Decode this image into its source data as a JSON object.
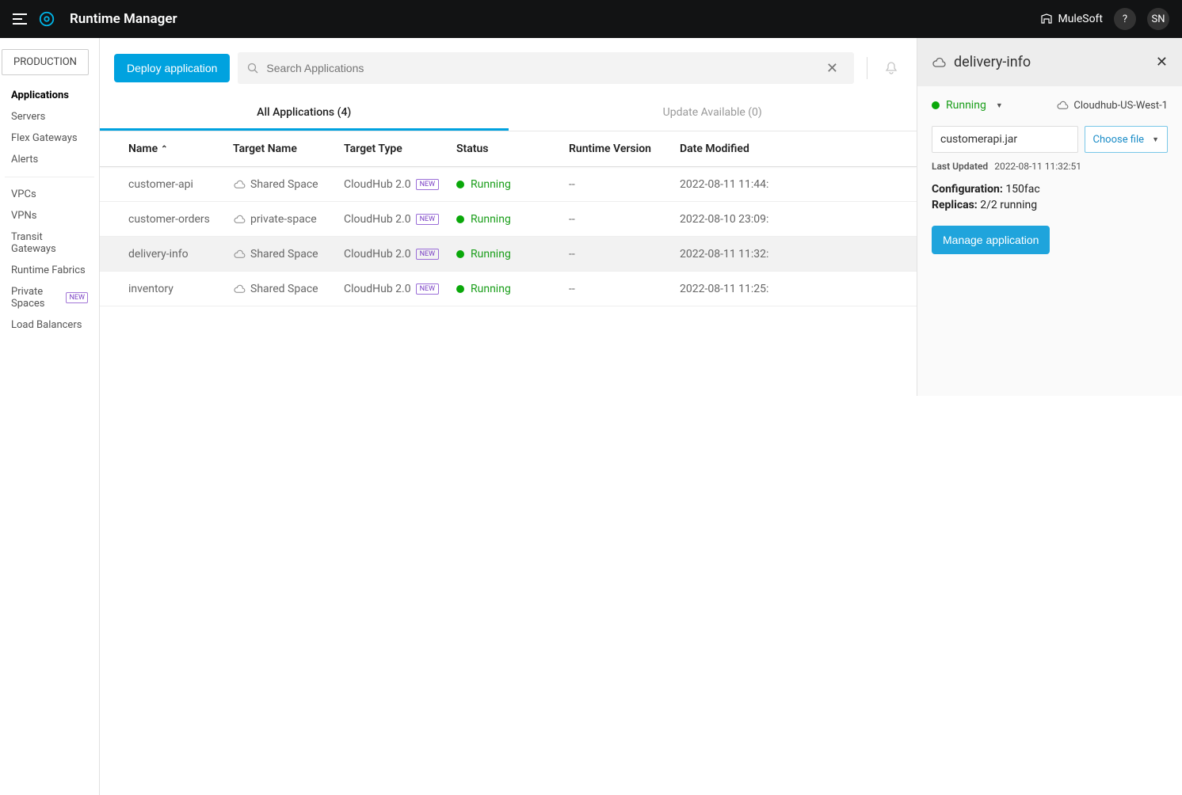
{
  "header": {
    "title": "Runtime Manager",
    "org": "MuleSoft",
    "user_initials": "SN"
  },
  "sidebar": {
    "env": "PRODUCTION",
    "group1": [
      {
        "label": "Applications",
        "active": true
      },
      {
        "label": "Servers"
      },
      {
        "label": "Flex Gateways"
      },
      {
        "label": "Alerts"
      }
    ],
    "group2": [
      {
        "label": "VPCs"
      },
      {
        "label": "VPNs"
      },
      {
        "label": "Transit Gateways"
      },
      {
        "label": "Runtime Fabrics"
      },
      {
        "label": "Private Spaces",
        "badge": "NEW"
      },
      {
        "label": "Load Balancers"
      }
    ]
  },
  "toolbar": {
    "deploy_label": "Deploy application",
    "search_placeholder": "Search Applications"
  },
  "tabs": {
    "all": "All Applications (4)",
    "update": "Update Available (0)"
  },
  "columns": {
    "name": "Name",
    "target": "Target Name",
    "type": "Target Type",
    "status": "Status",
    "runtime": "Runtime Version",
    "date": "Date Modified"
  },
  "badges": {
    "new": "NEW"
  },
  "rows": [
    {
      "name": "customer-api",
      "target": "Shared Space",
      "type": "CloudHub 2.0",
      "new": true,
      "status": "Running",
      "runtime": "--",
      "date": "2022-08-11 11:44:"
    },
    {
      "name": "customer-orders",
      "target": "private-space",
      "type": "CloudHub 2.0",
      "new": true,
      "status": "Running",
      "runtime": "--",
      "date": "2022-08-10 23:09:"
    },
    {
      "name": "delivery-info",
      "target": "Shared Space",
      "type": "CloudHub 2.0",
      "new": true,
      "status": "Running",
      "runtime": "--",
      "date": "2022-08-11 11:32:",
      "selected": true
    },
    {
      "name": "inventory",
      "target": "Shared Space",
      "type": "CloudHub 2.0",
      "new": true,
      "status": "Running",
      "runtime": "--",
      "date": "2022-08-11 11:25:"
    }
  ],
  "details": {
    "title": "delivery-info",
    "status": "Running",
    "region": "Cloudhub-US-West-1",
    "file": "customerapi.jar",
    "choose_label": "Choose file",
    "last_updated_label": "Last Updated",
    "last_updated": "2022-08-11 11:32:51",
    "config_label": "Configuration:",
    "config_value": "150fac",
    "replicas_label": "Replicas:",
    "replicas_value": "2/2 running",
    "manage_label": "Manage application"
  }
}
